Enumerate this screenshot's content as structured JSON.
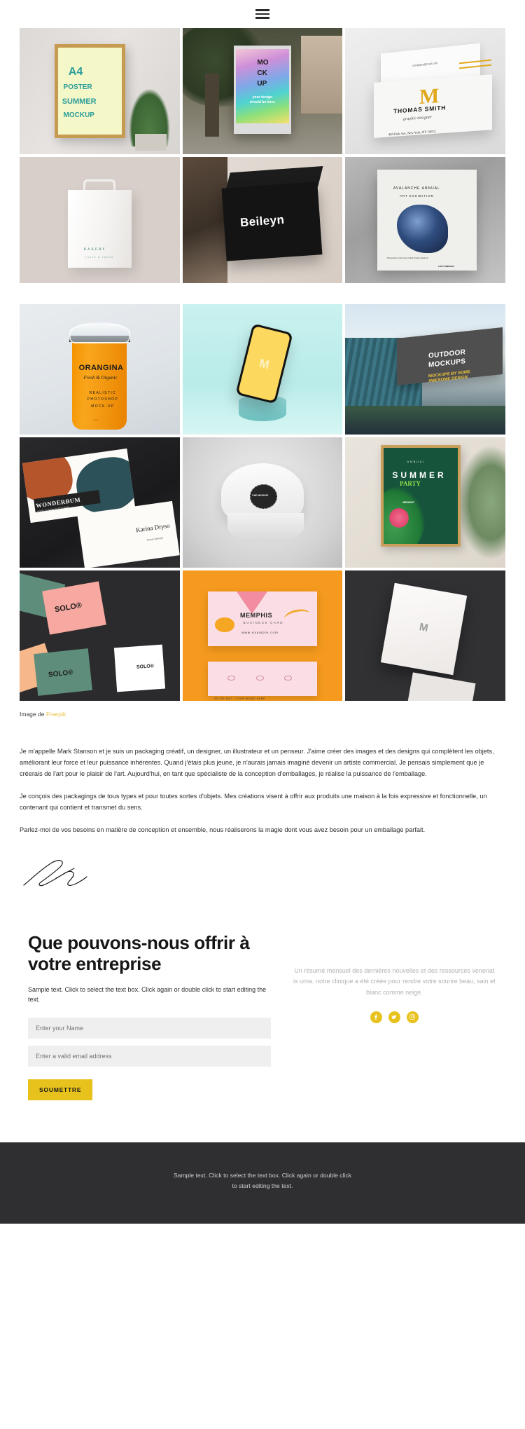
{
  "header": {
    "menu_icon": "hamburger-menu-icon"
  },
  "gallery": {
    "block1": [
      {
        "art": "m-poster",
        "name": "a4-poster-summer-mockup",
        "texts": {
          "l1": "A4",
          "l2": "POSTER",
          "l3": "SUMMER",
          "l4": "MOCKUP"
        }
      },
      {
        "art": "m-street",
        "name": "street-kiosk-mockup",
        "texts": {
          "l1": "MO",
          "l2": "CK",
          "l3": "UP",
          "l4": "your design should be here."
        }
      },
      {
        "art": "m-tsmith",
        "name": "thomas-smith-business-card-mockup",
        "texts": {
          "l1": "THOMAS SMITH",
          "l2": "graphic designer",
          "l3": "483 Park Ave, New York, NY 10022,",
          "l4": "company@mail.com"
        }
      },
      {
        "art": "m-bag",
        "name": "bakery-paper-bag-mockup",
        "texts": {
          "l1": "BAKERY",
          "l2": "TASTE & FRESH"
        }
      },
      {
        "art": "m-beileyn",
        "name": "beileyn-black-box-mockup",
        "texts": {
          "l1": "Beileyn"
        }
      },
      {
        "art": "m-avalanche",
        "name": "avalanche-art-poster-mockup",
        "texts": {
          "l1": "AVALANCHE ANNUAL",
          "l2": "ART EXHIBITION",
          "l3": "Showcasing in the theme of fluid & liquid marble art",
          "l4": "LOST SIMPSON"
        }
      }
    ],
    "block2": [
      {
        "art": "m-orangina",
        "name": "orangina-cup-mockup",
        "texts": {
          "l1": "ORANGINA",
          "l2": "Fresh & Organic",
          "l3": "REALISTIC PHOTOSHOP MOCK-UP",
          "l4": "100%"
        }
      },
      {
        "art": "m-phone",
        "name": "phone-screen-mockup",
        "texts": {
          "l1": "M"
        }
      },
      {
        "art": "m-outdoor",
        "name": "outdoor-billboard-mockup",
        "texts": {
          "l1": "OUTDOOR",
          "l2": "MOCKUPS",
          "l3": "MOCKUPS BY SOME AWESOME DESIGN"
        }
      },
      {
        "art": "m-wonder",
        "name": "wonderbum-business-card-mockup",
        "texts": {
          "l1": "WONDERBUM",
          "l2": "YOUR SLOGAN GOES HERE",
          "l3": "Karina Dryso",
          "l4": "Branch Manager"
        }
      },
      {
        "art": "m-cap",
        "name": "cap-mockup",
        "texts": {
          "l1": "CAP MOCKUP"
        }
      },
      {
        "art": "m-summer",
        "name": "summer-party-poster-mockup",
        "texts": {
          "l1": "ANNUAL",
          "l2": "SUMMER",
          "l3": "PARTY",
          "l4": "MIDNIGHT"
        }
      },
      {
        "art": "m-solo",
        "name": "solo-business-cards-mockup",
        "texts": {
          "l1": "SOLO®",
          "l2": "SOLO®",
          "l3": "SOLO®"
        }
      },
      {
        "art": "m-memphis",
        "name": "memphis-business-card-mockup",
        "texts": {
          "l1": "MEMPHIS",
          "l2": "BUSINESS CARD",
          "l3": "www.example.com",
          "l4": "00-123-4567 | YOUR BRAND NAME"
        }
      },
      {
        "art": "m-letter",
        "name": "letterhead-dark-mockup",
        "texts": {
          "l1": "M"
        }
      }
    ]
  },
  "credit": {
    "prefix": "Image de ",
    "link_label": "Freepik",
    "link_color": "#e8c547"
  },
  "bio": {
    "paragraphs": [
      "Je m'appelle Mark Stanson et je suis un packaging créatif, un designer, un illustrateur et un penseur. J'aime créer des images et des designs qui complètent les objets, améliorant leur force et leur puissance inhérentes. Quand j'étais plus jeune, je n'aurais jamais imaginé devenir un artiste commercial. Je pensais simplement que je créerais de l'art pour le plaisir de l'art. Aujourd'hui, en tant que spécialiste de la conception d'emballages, je réalise la puissance de l'emballage.",
      "Je conçois des packagings de tous types et pour toutes sortes d'objets. Mes créations visent à offrir aux produits une maison à la fois expressive et fonctionnelle, un contenant qui contient et transmet du sens.",
      "Parlez-moi de vos besoins en matière de conception et ensemble, nous réaliserons la magie dont vous avez besoin pour un emballage parfait."
    ]
  },
  "contact": {
    "heading": "Que pouvons-nous offrir à votre entreprise",
    "sample_text": "Sample text. Click to select the text box. Click again or double click to start editing the text.",
    "name_placeholder": "Enter your Name",
    "email_placeholder": "Enter a valid email address",
    "name_value": "",
    "email_value": "",
    "submit_label": "SOUMETTRE",
    "submit_color": "#e8c21c",
    "summary_text": "Un résumé mensuel des dernières nouvelles et des ressources venenat is urna. notre clinique a été créée pour rendre votre sourire beau, sain et blanc comme neige.",
    "socials": [
      {
        "name": "facebook-icon",
        "label": "Facebook"
      },
      {
        "name": "twitter-icon",
        "label": "Twitter"
      },
      {
        "name": "instagram-icon",
        "label": "Instagram"
      }
    ]
  },
  "footer": {
    "text": "Sample text. Click to select the text box. Click again or double click to start editing the text.",
    "background": "#2f2f31"
  }
}
